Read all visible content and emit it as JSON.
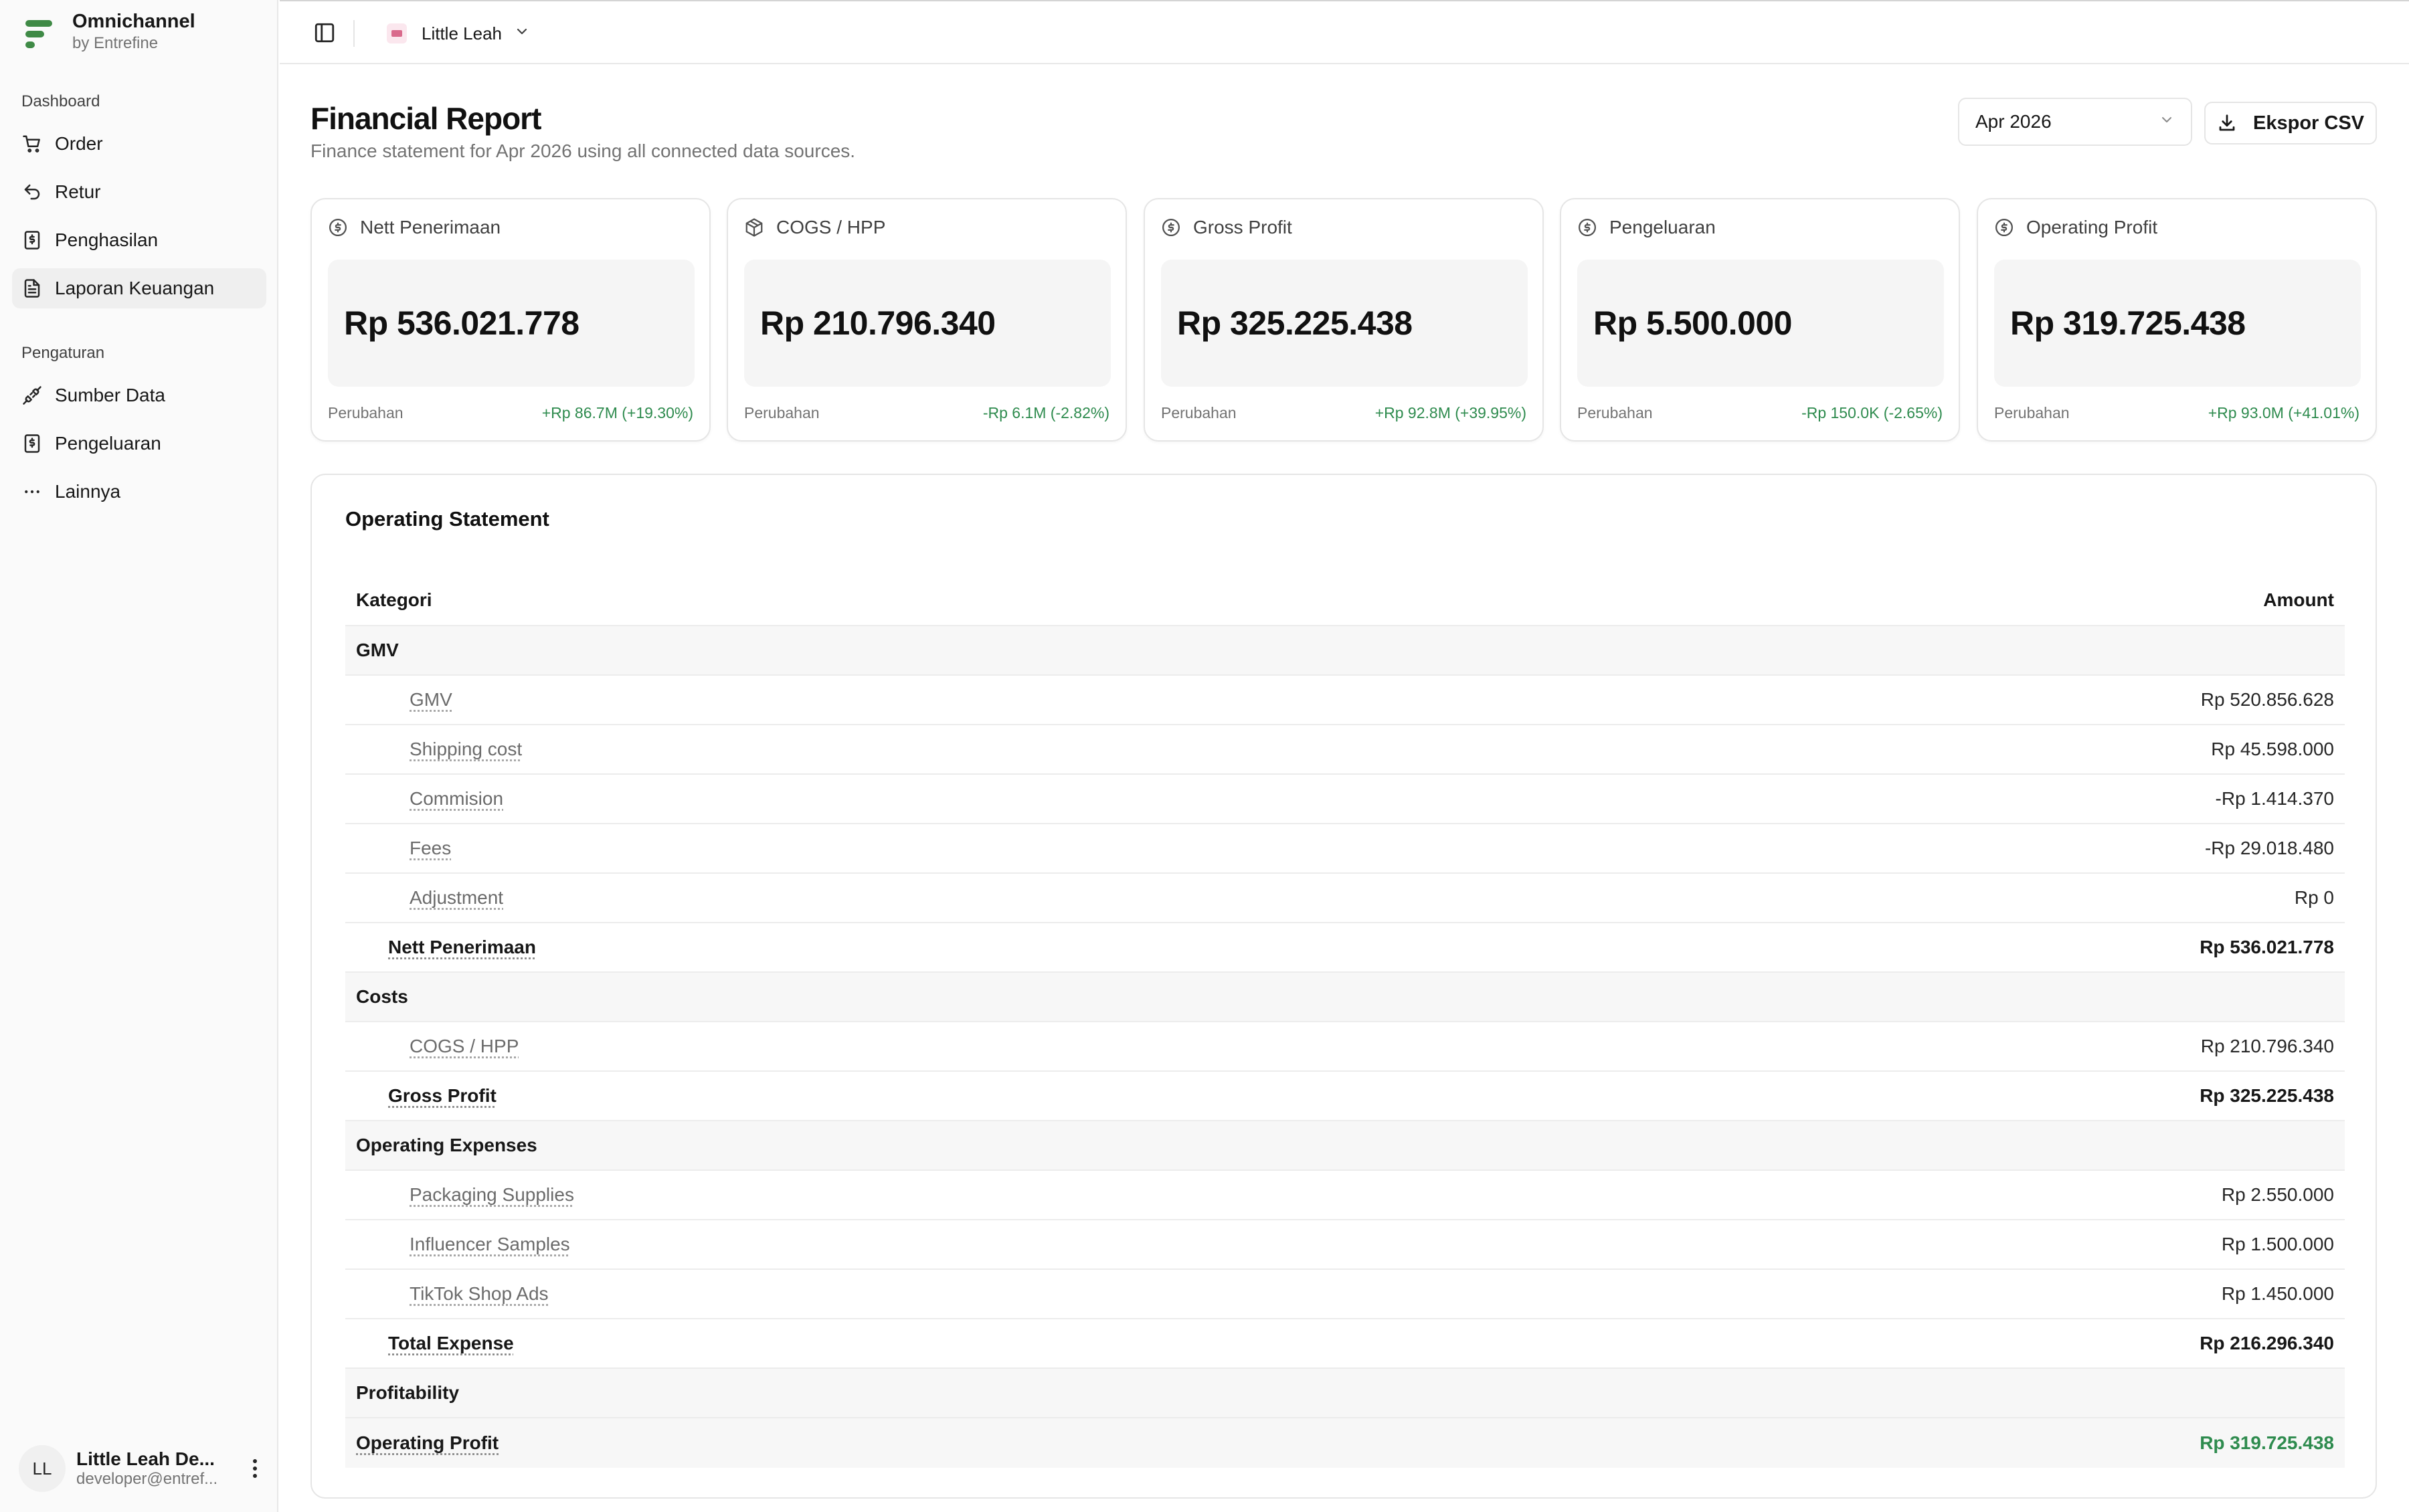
{
  "brand": {
    "name": "Omnichannel",
    "sub": "by Entrefine"
  },
  "sidebar": {
    "section1": "Dashboard",
    "items1": [
      {
        "label": "Order",
        "icon": "cart-icon"
      },
      {
        "label": "Retur",
        "icon": "undo-icon"
      },
      {
        "label": "Penghasilan",
        "icon": "receipt-icon"
      },
      {
        "label": "Laporan Keuangan",
        "icon": "document-icon",
        "active": true
      }
    ],
    "section2": "Pengaturan",
    "items2": [
      {
        "label": "Sumber Data",
        "icon": "plug-icon"
      },
      {
        "label": "Pengeluaran",
        "icon": "receipt-icon"
      },
      {
        "label": "Lainnya",
        "icon": "more-horizontal-icon"
      }
    ]
  },
  "user": {
    "initials": "LL",
    "name": "Little Leah De...",
    "email": "developer@entref..."
  },
  "topbar": {
    "store": "Little Leah"
  },
  "header": {
    "title": "Financial Report",
    "subtitle": "Finance statement for Apr 2026 using all connected data sources.",
    "period": "Apr 2026",
    "export_label": "Ekspor CSV"
  },
  "cards": [
    {
      "title": "Nett Penerimaan",
      "value": "Rp 536.021.778",
      "change_label": "Perubahan",
      "change": "+Rp 86.7M (+19.30%)"
    },
    {
      "title": "COGS / HPP",
      "value": "Rp 210.796.340",
      "change_label": "Perubahan",
      "change": "-Rp 6.1M (-2.82%)"
    },
    {
      "title": "Gross Profit",
      "value": "Rp 325.225.438",
      "change_label": "Perubahan",
      "change": "+Rp 92.8M (+39.95%)"
    },
    {
      "title": "Pengeluaran",
      "value": "Rp 5.500.000",
      "change_label": "Perubahan",
      "change": "-Rp 150.0K (-2.65%)"
    },
    {
      "title": "Operating Profit",
      "value": "Rp 319.725.438",
      "change_label": "Perubahan",
      "change": "+Rp 93.0M (+41.01%)"
    }
  ],
  "statement": {
    "title": "Operating Statement",
    "col_category": "Kategori",
    "col_amount": "Amount",
    "rows": [
      {
        "type": "group",
        "label": "GMV",
        "amount": ""
      },
      {
        "type": "item",
        "label": "GMV",
        "amount": "Rp 520.856.628"
      },
      {
        "type": "item",
        "label": "Shipping cost",
        "amount": "Rp 45.598.000"
      },
      {
        "type": "item",
        "label": "Commision",
        "amount": "-Rp 1.414.370"
      },
      {
        "type": "item",
        "label": "Fees",
        "amount": "-Rp 29.018.480"
      },
      {
        "type": "item",
        "label": "Adjustment",
        "amount": "Rp 0"
      },
      {
        "type": "subtotal",
        "label": "Nett Penerimaan",
        "amount": "Rp 536.021.778"
      },
      {
        "type": "group",
        "label": "Costs",
        "amount": ""
      },
      {
        "type": "item",
        "label": "COGS / HPP",
        "amount": "Rp 210.796.340"
      },
      {
        "type": "subtotal",
        "label": "Gross Profit",
        "amount": "Rp 325.225.438"
      },
      {
        "type": "group",
        "label": "Operating Expenses",
        "amount": ""
      },
      {
        "type": "item",
        "label": "Packaging Supplies",
        "amount": "Rp 2.550.000"
      },
      {
        "type": "item",
        "label": "Influencer Samples",
        "amount": "Rp 1.500.000"
      },
      {
        "type": "item",
        "label": "TikTok Shop Ads",
        "amount": "Rp 1.450.000"
      },
      {
        "type": "subtotal",
        "label": "Total Expense",
        "amount": "Rp 216.296.340"
      },
      {
        "type": "group",
        "label": "Profitability",
        "amount": ""
      },
      {
        "type": "final",
        "label": "Operating Profit",
        "amount": "Rp 319.725.438"
      }
    ]
  },
  "colors": {
    "brand": "#3f8a46",
    "positive": "#2e8b4e"
  }
}
